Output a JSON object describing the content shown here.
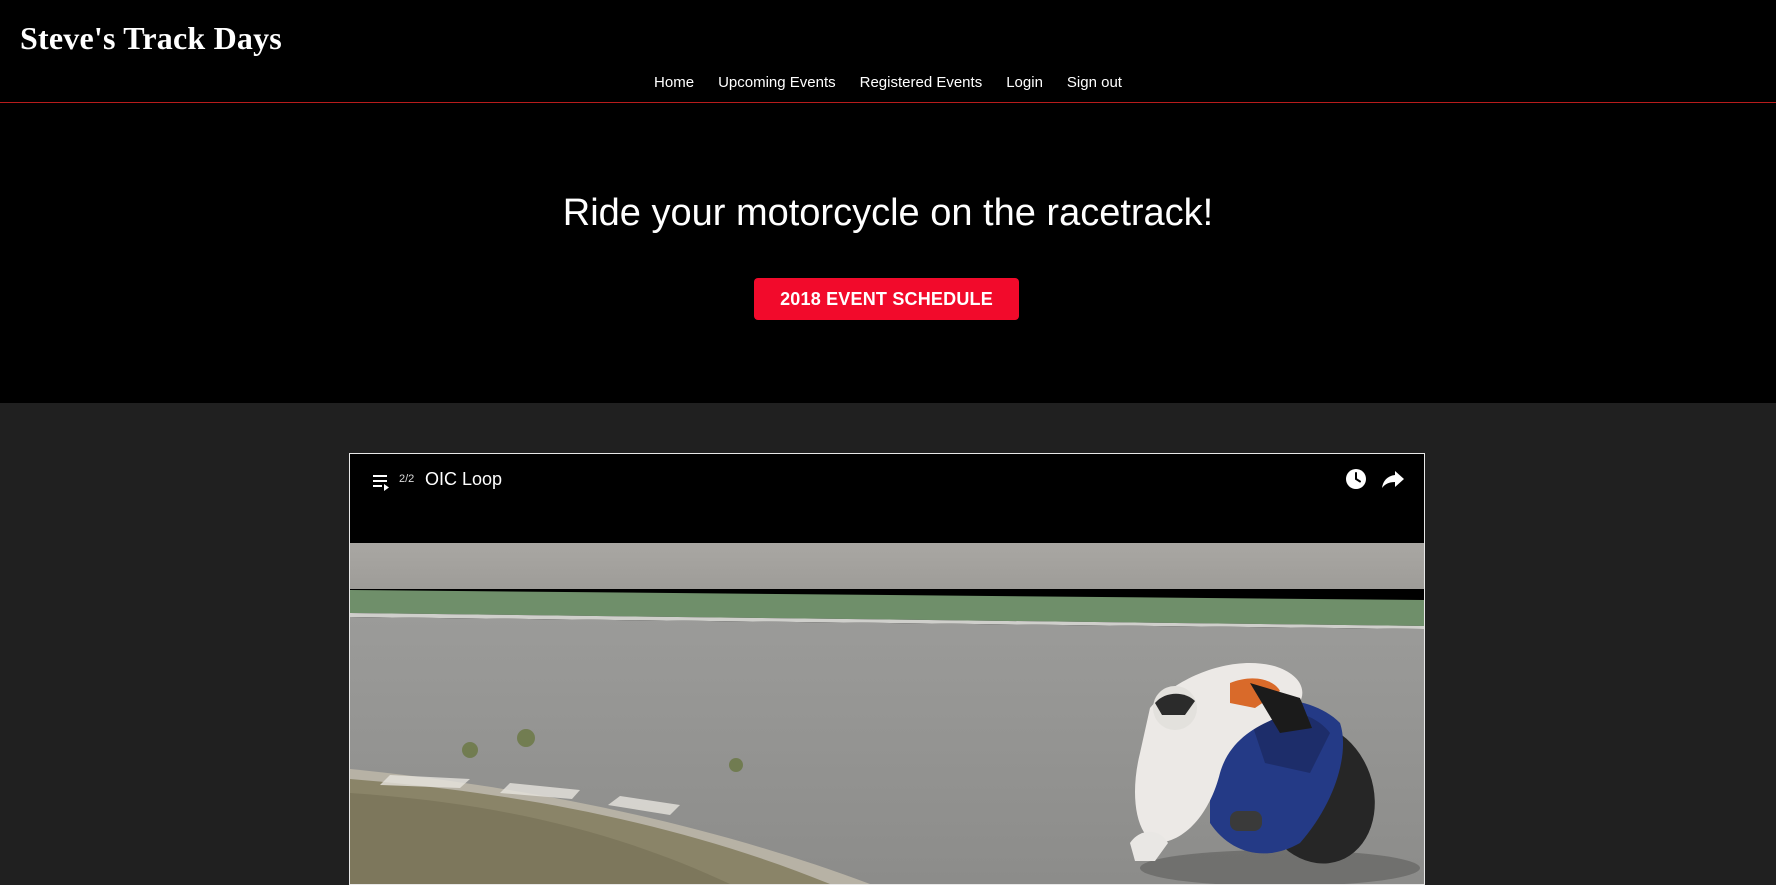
{
  "header": {
    "brand": "Steve's Track Days",
    "nav": [
      {
        "label": "Home"
      },
      {
        "label": "Upcoming Events"
      },
      {
        "label": "Registered Events"
      },
      {
        "label": "Login"
      },
      {
        "label": "Sign out"
      }
    ]
  },
  "hero": {
    "title": "Ride your motorcycle on the racetrack!",
    "button_label": "2018 EVENT SCHEDULE"
  },
  "video": {
    "playlist_position": "2/2",
    "title": "OIC Loop",
    "icons": [
      "playlist-icon",
      "watch-later-icon",
      "share-icon"
    ]
  },
  "colors": {
    "accent": "#f20a2b",
    "header_border": "#b71c1c",
    "page_background": "#202020",
    "header_background": "#000000"
  }
}
